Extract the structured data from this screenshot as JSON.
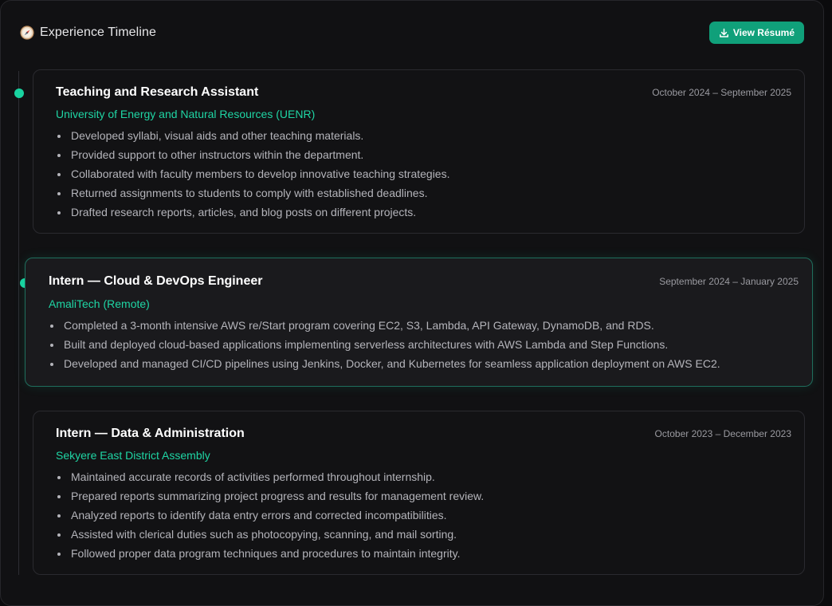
{
  "header": {
    "title": "Experience Timeline",
    "title_icon": "compass-icon",
    "resume_button_label": "View Résumé",
    "resume_button_icon": "download-icon"
  },
  "colors": {
    "accent": "#19d3a0",
    "button": "#10a07a",
    "background": "#111113"
  },
  "experiences": [
    {
      "role": "Teaching and Research Assistant",
      "dates": "October 2024 – September 2025",
      "org": "University of Energy and Natural Resources (UENR)",
      "bullets": [
        "Developed syllabi, visual aids and other teaching materials.",
        "Provided support to other instructors within the department.",
        "Collaborated with faculty members to develop innovative teaching strategies.",
        "Returned assignments to students to comply with established deadlines.",
        "Drafted research reports, articles, and blog posts on different projects."
      ]
    },
    {
      "role": "Intern — Cloud & DevOps Engineer",
      "dates": "September 2024 – January 2025",
      "org": "AmaliTech (Remote)",
      "bullets": [
        "Completed a 3-month intensive AWS re/Start program covering EC2, S3, Lambda, API Gateway, DynamoDB, and RDS.",
        "Built and deployed cloud-based applications implementing serverless architectures with AWS Lambda and Step Functions.",
        "Developed and managed CI/CD pipelines using Jenkins, Docker, and Kubernetes for seamless application deployment on AWS EC2."
      ]
    },
    {
      "role": "Intern — Data & Administration",
      "dates": "October 2023 – December 2023",
      "org": "Sekyere East District Assembly",
      "bullets": [
        "Maintained accurate records of activities performed throughout internship.",
        "Prepared reports summarizing project progress and results for management review.",
        "Analyzed reports to identify data entry errors and corrected incompatibilities.",
        "Assisted with clerical duties such as photocopying, scanning, and mail sorting.",
        "Followed proper data program techniques and procedures to maintain integrity."
      ]
    }
  ]
}
